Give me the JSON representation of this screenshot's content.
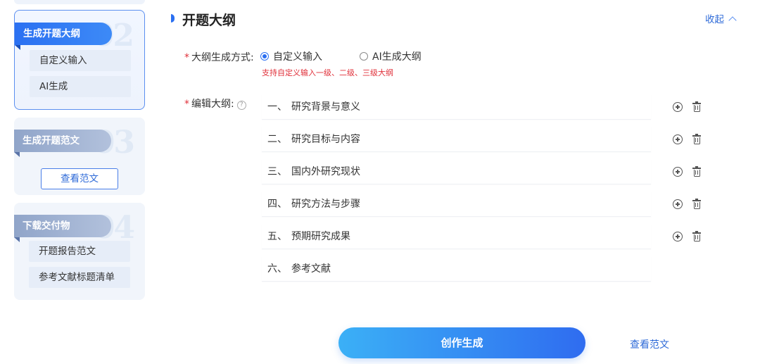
{
  "sidebar": {
    "cards": [
      {
        "number": "02",
        "title": "生成开题大纲",
        "active": true,
        "items": [
          "自定义输入",
          "AI生成"
        ]
      },
      {
        "number": "03",
        "title": "生成开题范文",
        "active": false,
        "button": "查看范文"
      },
      {
        "number": "04",
        "title": "下载交付物",
        "active": false,
        "items": [
          "开题报告范文",
          "参考文献标题清单"
        ]
      }
    ]
  },
  "section": {
    "title": "开题大纲",
    "collapse_label": "收起"
  },
  "form": {
    "mode_label": "大纲生成方式:",
    "mode_options": [
      {
        "label": "自定义输入",
        "selected": true
      },
      {
        "label": "AI生成大纲",
        "selected": false
      }
    ],
    "mode_hint": "支持自定义输入一级、二级、三级大纲",
    "outline_label": "编辑大纲:",
    "help_icon": "?",
    "outline_items": [
      {
        "num": "一、",
        "text": "研究背景与意义"
      },
      {
        "num": "二、",
        "text": "研究目标与内容"
      },
      {
        "num": "三、",
        "text": "国内外研究现状"
      },
      {
        "num": "四、",
        "text": "研究方法与步骤"
      },
      {
        "num": "五、",
        "text": "预期研究成果"
      },
      {
        "num": "六、",
        "text": "参考文献"
      }
    ]
  },
  "footer": {
    "create_label": "创作生成",
    "view_sample_label": "查看范文"
  },
  "colors": {
    "primary": "#2a6ff1",
    "required": "#e0303a",
    "link": "#2f6bd8"
  },
  "icons": [
    "plus-circle-icon",
    "trash-icon",
    "help-icon",
    "chevron-up-icon"
  ]
}
